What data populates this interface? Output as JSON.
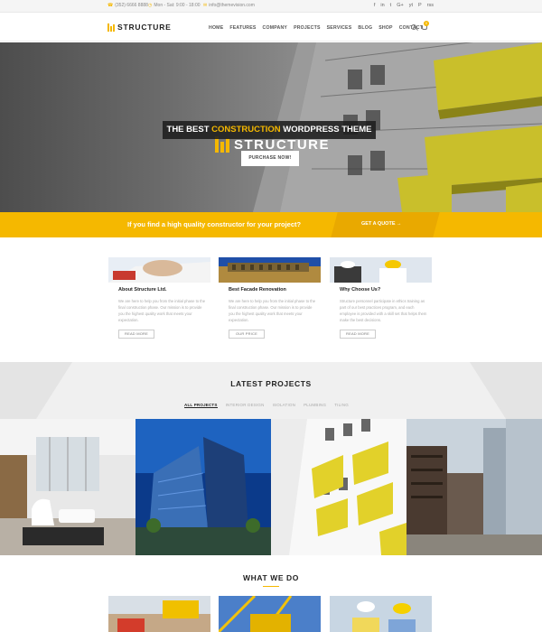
{
  "topbar": {
    "phone": "(352) 6666 8888",
    "hours": "Mon - Sat: 9:00 - 18:00",
    "email": "info@themevision.com",
    "social": [
      "f",
      "in",
      "t",
      "G+",
      "yt",
      "P",
      "rss"
    ]
  },
  "header": {
    "logo_text": "STRUCTURE",
    "nav": [
      "HOME",
      "FEATURES",
      "COMPANY",
      "PROJECTS",
      "SERVICES",
      "BLOG",
      "SHOP",
      "CONTACT"
    ],
    "cart_count": "0"
  },
  "hero": {
    "logo_text": "STRUCTURE",
    "tagline_before": "THE BEST ",
    "tagline_highlight": "CONSTRUCTION",
    "tagline_after": " WORDPRESS THEME",
    "button": "PURCHASE NOW!"
  },
  "cta": {
    "text": "If you find a high quality constructor for your project?",
    "button": "GET A QUOTE →"
  },
  "cards": [
    {
      "title": "About Structure Ltd.",
      "desc": "We are here to help you from the initial phase to the final construction phase. Our mission is to provide you the highest quality work that meets your expectation.",
      "button": "READ MORE"
    },
    {
      "title": "Best Facade Renovation",
      "desc": "We are here to help you from the initial phase to the final construction phase. Our mission is to provide you the highest quality work that meets your expectation.",
      "button": "OUR PRICE"
    },
    {
      "title": "Why Choose Us?",
      "desc": "Structure personnel participate in ethics training as part of our best practices program, and each employee is provided with a skill set that helps them make the best decisions.",
      "button": "READ MORE"
    }
  ],
  "projects": {
    "title": "LATEST PROJECTS",
    "filters": [
      "ALL PROJECTS",
      "INTERIOR DESIGN",
      "ISOLATION",
      "PLUMBING",
      "TILING"
    ]
  },
  "what_we_do": {
    "title": "WHAT WE DO"
  },
  "colors": {
    "accent": "#f5b800",
    "dark": "#222222",
    "hero_yellow": "#c9bf2b"
  }
}
